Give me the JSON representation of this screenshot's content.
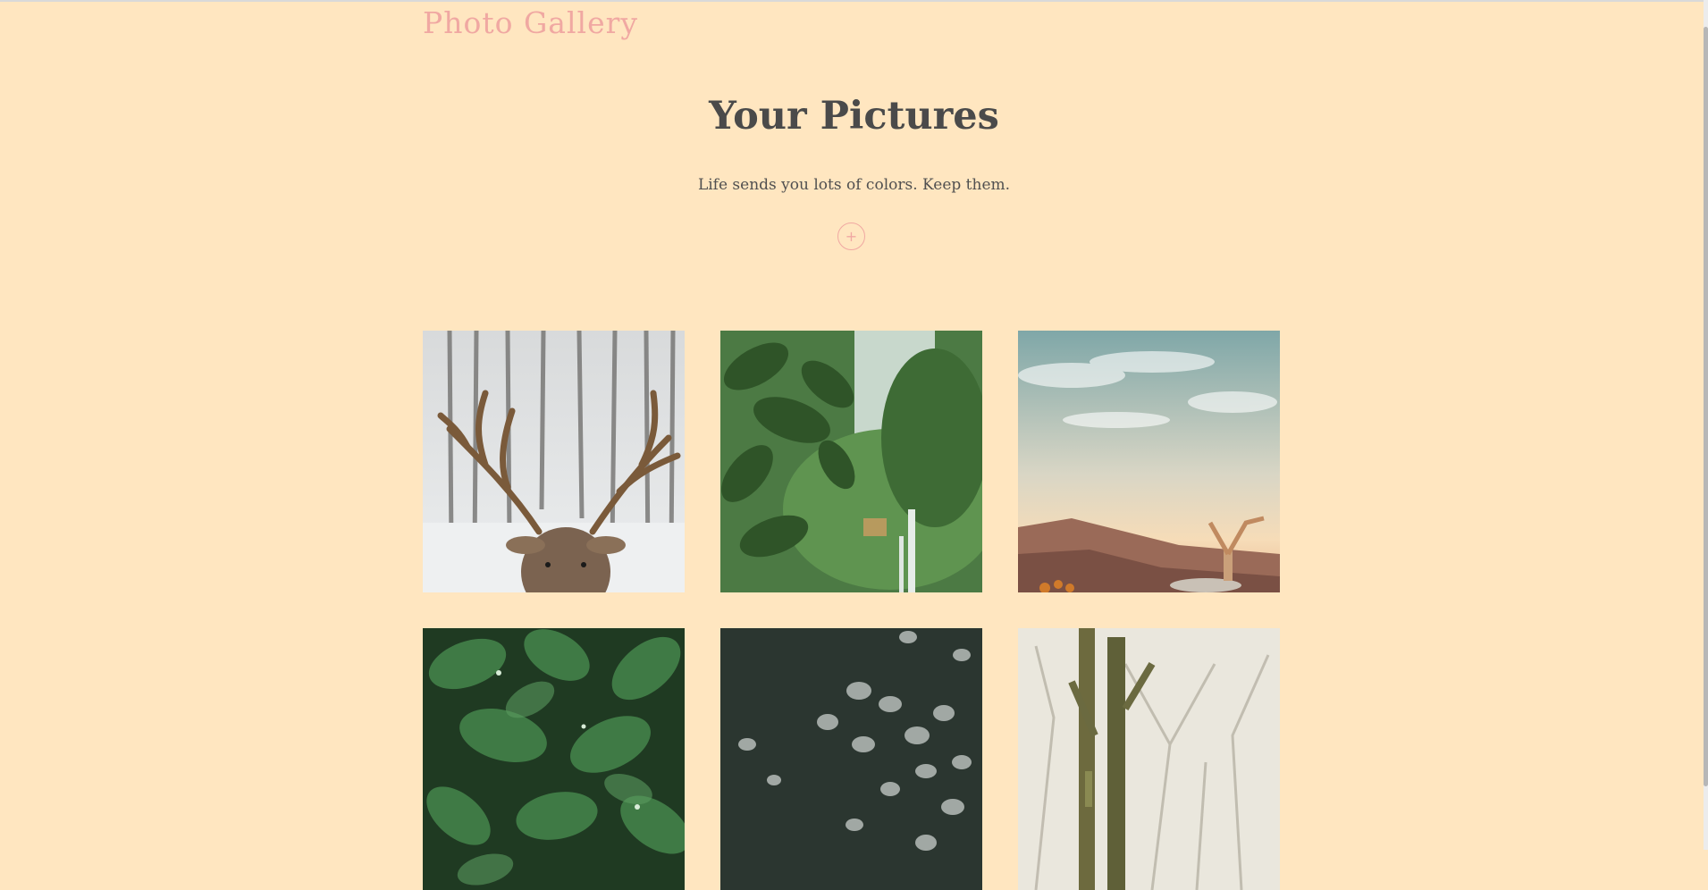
{
  "header": {
    "brand": "Photo Gallery"
  },
  "hero": {
    "title": "Your Pictures",
    "subtitle": "Life sends you lots of colors. Keep them.",
    "add_label": "+"
  },
  "gallery": {
    "photos": [
      {
        "subject": "deer-with-antlers-snowy-forest"
      },
      {
        "subject": "jungle-waterfall-leaves"
      },
      {
        "subject": "handstand-on-cliff-sunset"
      },
      {
        "subject": "green-leaves-water-drops"
      },
      {
        "subject": "jellyfish-dark-water"
      },
      {
        "subject": "mossy-trees-misty-forest"
      }
    ]
  },
  "colors": {
    "background": "#ffe6c0",
    "accent": "#f0a8a2",
    "text": "#4a4a4a"
  }
}
